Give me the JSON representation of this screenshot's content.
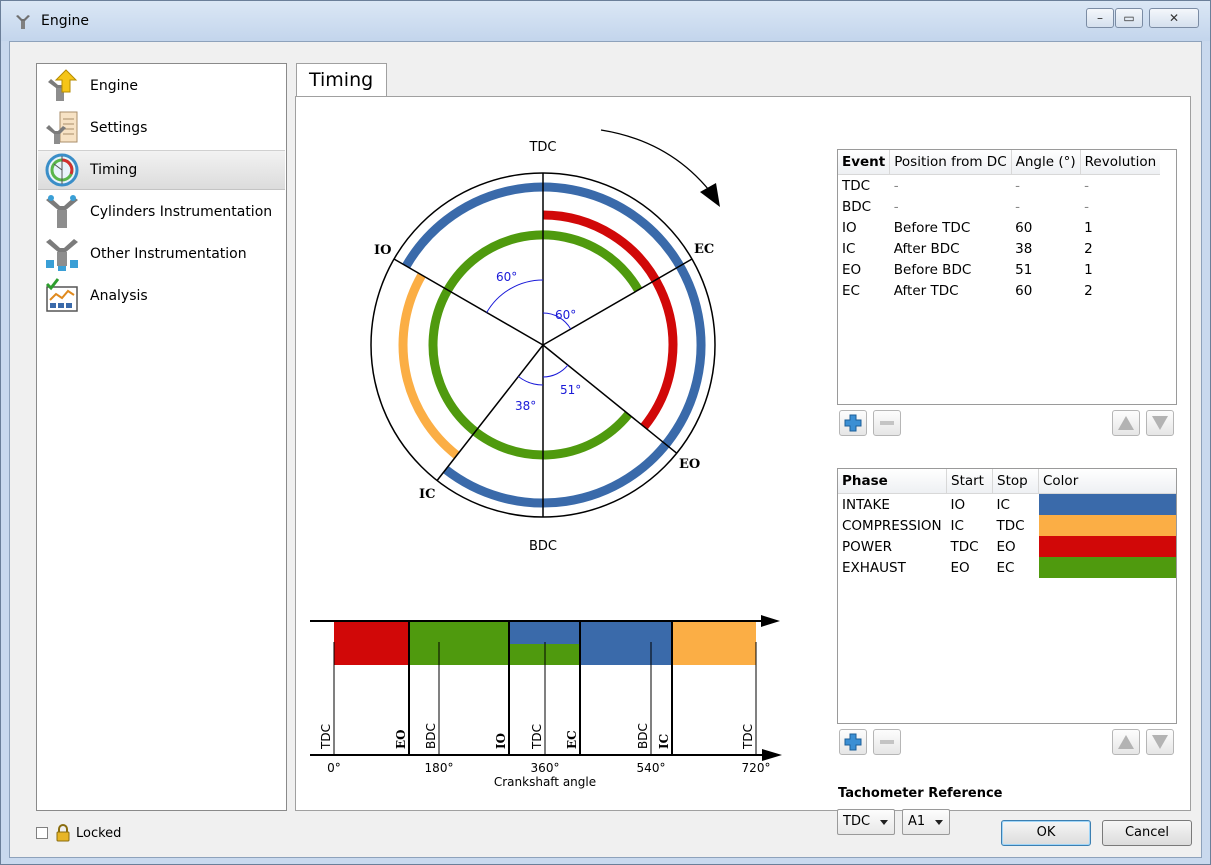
{
  "window": {
    "title": "Engine",
    "controls": [
      "–",
      "▭",
      "✕"
    ]
  },
  "sidebar": {
    "items": [
      {
        "label": "Engine",
        "icon": "engine-upload-icon"
      },
      {
        "label": "Settings",
        "icon": "settings-document-icon"
      },
      {
        "label": "Timing",
        "icon": "timing-dial-icon",
        "selected": true
      },
      {
        "label": "Cylinders Instrumentation",
        "icon": "cylinders-icon"
      },
      {
        "label": "Other Instrumentation",
        "icon": "instrumentation-icon"
      },
      {
        "label": "Analysis",
        "icon": "analysis-chart-icon"
      }
    ]
  },
  "tab": {
    "label": "Timing"
  },
  "circle_diagram": {
    "labels": {
      "tdc": "TDC",
      "bdc": "BDC",
      "io": "IO",
      "ec": "EC",
      "eo": "EO",
      "ic": "IC"
    },
    "angles": {
      "io": "60°",
      "ec": "60°",
      "eo": "51°",
      "ic": "38°"
    }
  },
  "linear_diagram": {
    "xlabel": "Crankshaft angle",
    "ticks": [
      "0°",
      "180°",
      "360°",
      "540°",
      "720°"
    ],
    "events": [
      {
        "label": "TDC",
        "bold": false
      },
      {
        "label": "EO",
        "bold": true
      },
      {
        "label": "BDC",
        "bold": false
      },
      {
        "label": "IO",
        "bold": true
      },
      {
        "label": "TDC",
        "bold": false
      },
      {
        "label": "EC",
        "bold": true
      },
      {
        "label": "BDC",
        "bold": false
      },
      {
        "label": "IC",
        "bold": true
      },
      {
        "label": "TDC",
        "bold": false
      }
    ]
  },
  "events_table": {
    "headers": [
      "Event",
      "Position from DC",
      "Angle (°)",
      "Revolution"
    ],
    "rows": [
      [
        "TDC",
        "-",
        "-",
        "-"
      ],
      [
        "BDC",
        "-",
        "-",
        "-"
      ],
      [
        "IO",
        "Before TDC",
        "60",
        "1"
      ],
      [
        "IC",
        "After BDC",
        "38",
        "2"
      ],
      [
        "EO",
        "Before BDC",
        "51",
        "1"
      ],
      [
        "EC",
        "After TDC",
        "60",
        "2"
      ]
    ]
  },
  "phases_table": {
    "headers": [
      "Phase",
      "Start",
      "Stop",
      "Color"
    ],
    "rows": [
      {
        "phase": "INTAKE",
        "start": "IO",
        "stop": "IC",
        "color": "#3a6aaa"
      },
      {
        "phase": "COMPRESSION",
        "start": "IC",
        "stop": "TDC",
        "color": "#fbae45"
      },
      {
        "phase": "POWER",
        "start": "TDC",
        "stop": "EO",
        "color": "#d10808"
      },
      {
        "phase": "EXHAUST",
        "start": "EO",
        "stop": "EC",
        "color": "#4f9a0e"
      }
    ]
  },
  "tachometer": {
    "label": "Tachometer Reference",
    "reference": "TDC",
    "channel": "A1"
  },
  "footer": {
    "locked_label": "Locked",
    "locked": false,
    "ok_label": "OK",
    "cancel_label": "Cancel"
  }
}
